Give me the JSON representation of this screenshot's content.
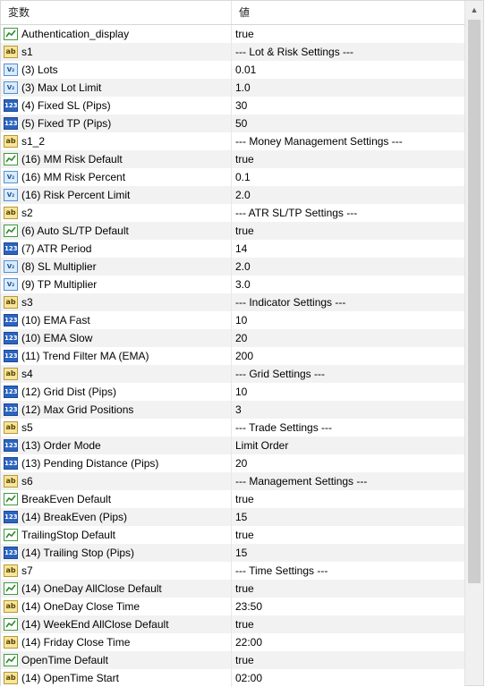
{
  "header": {
    "name_col": "変数",
    "value_col": "値"
  },
  "rows": [
    {
      "type": "bool",
      "name": "Authentication_display",
      "value": "true"
    },
    {
      "type": "str",
      "name": "s1",
      "value": "--- Lot & Risk Settings ---"
    },
    {
      "type": "dbl",
      "name": "(3) Lots",
      "value": "0.01"
    },
    {
      "type": "dbl",
      "name": "(3) Max Lot Limit",
      "value": "1.0"
    },
    {
      "type": "int",
      "name": "(4) Fixed SL (Pips)",
      "value": "30"
    },
    {
      "type": "int",
      "name": "(5) Fixed TP (Pips)",
      "value": "50"
    },
    {
      "type": "str",
      "name": "s1_2",
      "value": "--- Money Management Settings ---"
    },
    {
      "type": "bool",
      "name": "(16) MM Risk Default",
      "value": "true"
    },
    {
      "type": "dbl",
      "name": "(16) MM Risk Percent",
      "value": "0.1"
    },
    {
      "type": "dbl",
      "name": "(16) Risk Percent Limit",
      "value": "2.0"
    },
    {
      "type": "str",
      "name": "s2",
      "value": "--- ATR SL/TP Settings ---"
    },
    {
      "type": "bool",
      "name": "(6) Auto SL/TP Default",
      "value": "true"
    },
    {
      "type": "int",
      "name": "(7) ATR Period",
      "value": "14"
    },
    {
      "type": "dbl",
      "name": "(8) SL Multiplier",
      "value": "2.0"
    },
    {
      "type": "dbl",
      "name": "(9) TP Multiplier",
      "value": "3.0"
    },
    {
      "type": "str",
      "name": "s3",
      "value": "--- Indicator Settings ---"
    },
    {
      "type": "int",
      "name": "(10) EMA Fast",
      "value": "10"
    },
    {
      "type": "int",
      "name": "(10) EMA Slow",
      "value": "20"
    },
    {
      "type": "int",
      "name": "(11) Trend Filter MA (EMA)",
      "value": "200"
    },
    {
      "type": "str",
      "name": "s4",
      "value": "--- Grid Settings ---"
    },
    {
      "type": "int",
      "name": "(12) Grid Dist (Pips)",
      "value": "10"
    },
    {
      "type": "int",
      "name": "(12) Max Grid Positions",
      "value": "3"
    },
    {
      "type": "str",
      "name": "s5",
      "value": "--- Trade Settings ---"
    },
    {
      "type": "int",
      "name": "(13) Order Mode",
      "value": "Limit Order"
    },
    {
      "type": "int",
      "name": "(13) Pending Distance (Pips)",
      "value": "20"
    },
    {
      "type": "str",
      "name": "s6",
      "value": "--- Management Settings ---"
    },
    {
      "type": "bool",
      "name": "BreakEven Default",
      "value": "true"
    },
    {
      "type": "int",
      "name": "(14) BreakEven (Pips)",
      "value": "15"
    },
    {
      "type": "bool",
      "name": "TrailingStop Default",
      "value": "true"
    },
    {
      "type": "int",
      "name": "(14) Trailing Stop (Pips)",
      "value": "15"
    },
    {
      "type": "str",
      "name": "s7",
      "value": "--- Time Settings ---"
    },
    {
      "type": "bool",
      "name": "(14) OneDay AllClose Default",
      "value": "true"
    },
    {
      "type": "str",
      "name": "(14) OneDay Close Time",
      "value": "23:50"
    },
    {
      "type": "bool",
      "name": "(14) WeekEnd AllClose Default",
      "value": "true"
    },
    {
      "type": "str",
      "name": "(14) Friday Close Time",
      "value": "22:00"
    },
    {
      "type": "bool",
      "name": "OpenTime Default",
      "value": "true"
    },
    {
      "type": "str",
      "name": "(14) OpenTime Start",
      "value": "02:00"
    }
  ],
  "icon_glyphs": {
    "str": "ab",
    "dbl": "V₂",
    "int": "123"
  },
  "colors": {
    "row_alt": "#f2f2f2",
    "bool_icon": "#3e9a3e",
    "int_icon": "#2b64c0",
    "str_icon": "#f6e59a",
    "dbl_icon": "#d8ecff"
  }
}
